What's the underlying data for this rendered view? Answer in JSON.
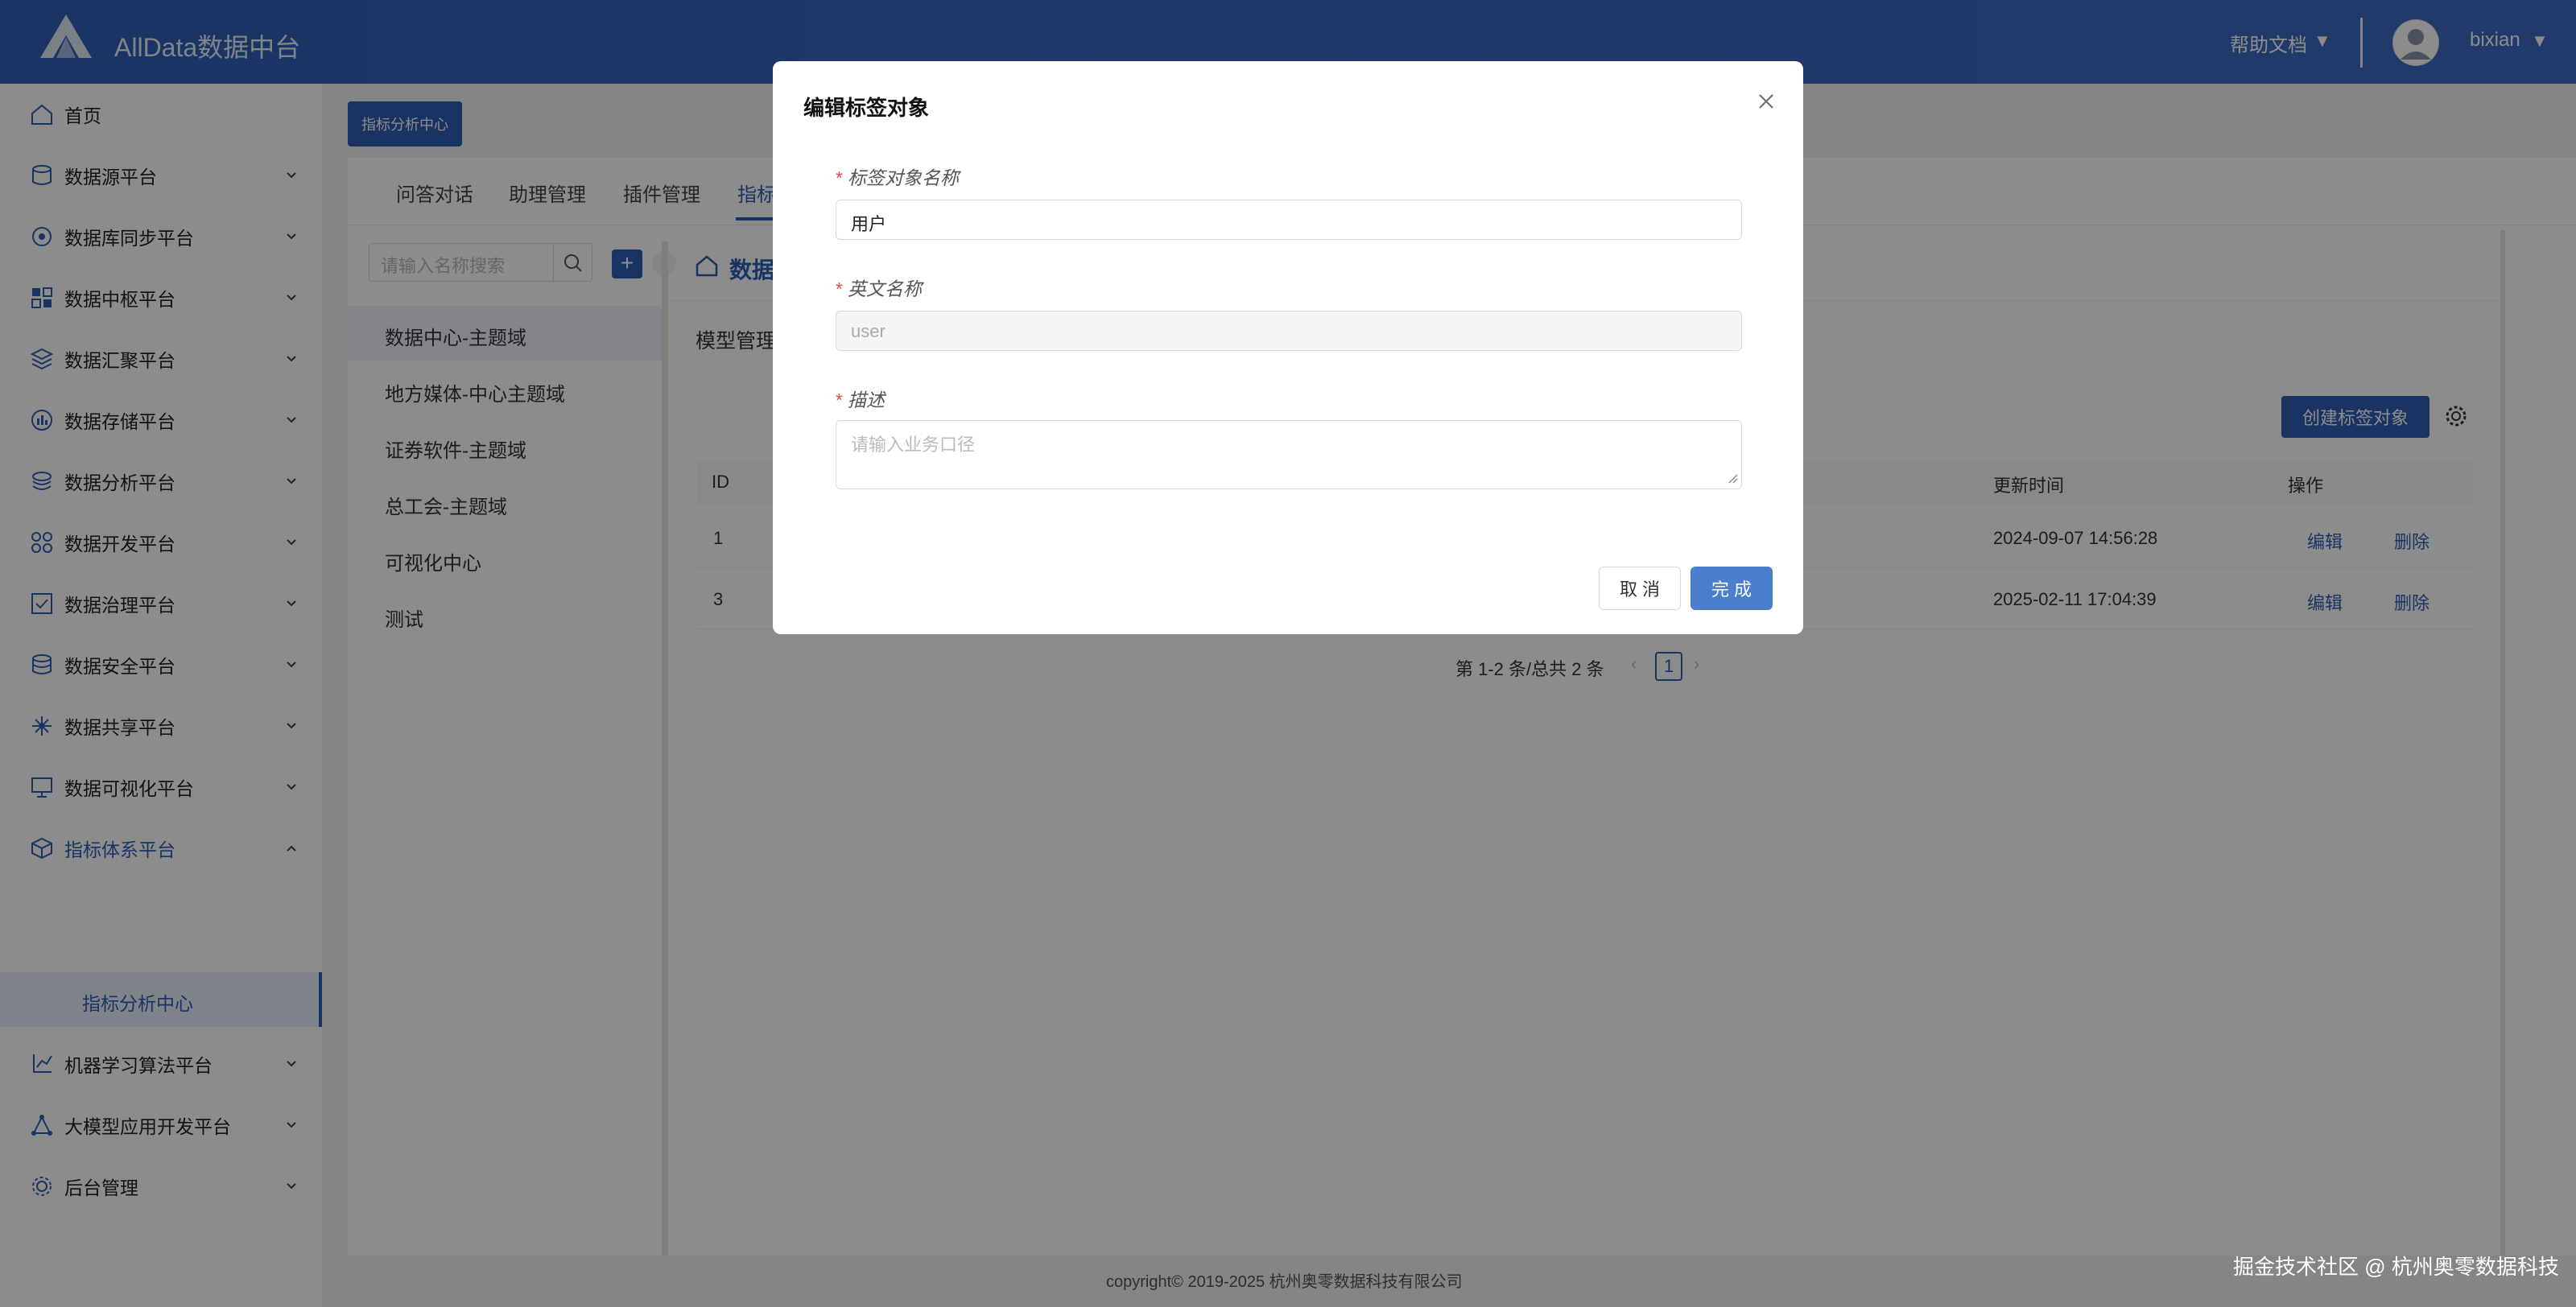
{
  "header": {
    "app_title": "AllData数据中台",
    "help_label": "帮助文档",
    "caret": "▼",
    "username": "bixian"
  },
  "sidebar": {
    "items": [
      {
        "label": "首页",
        "icon": "home-icon"
      },
      {
        "label": "数据源平台",
        "icon": "database-icon"
      },
      {
        "label": "数据库同步平台",
        "icon": "sync-icon"
      },
      {
        "label": "数据中枢平台",
        "icon": "grid-icon"
      },
      {
        "label": "数据汇聚平台",
        "icon": "stack-icon"
      },
      {
        "label": "数据存储平台",
        "icon": "storage-icon"
      },
      {
        "label": "数据分析平台",
        "icon": "layers-icon"
      },
      {
        "label": "数据开发平台",
        "icon": "apps-icon"
      },
      {
        "label": "数据治理平台",
        "icon": "check-icon"
      },
      {
        "label": "数据安全平台",
        "icon": "shield-db-icon"
      },
      {
        "label": "数据共享平台",
        "icon": "share-icon"
      },
      {
        "label": "数据可视化平台",
        "icon": "monitor-icon"
      },
      {
        "label": "指标体系平台",
        "icon": "cube-icon"
      },
      {
        "label": "机器学习算法平台",
        "icon": "ml-icon"
      },
      {
        "label": "大模型应用开发平台",
        "icon": "network-icon"
      },
      {
        "label": "后台管理",
        "icon": "admin-gear-icon"
      }
    ],
    "sub_item": "指标分析中心"
  },
  "content": {
    "tag_button": "指标分析中心",
    "tabs": [
      "问答对话",
      "助理管理",
      "插件管理",
      "指标"
    ],
    "search_placeholder": "请输入名称搜索",
    "plus": "+",
    "collapse": "‹",
    "tree": [
      "数据中心-主题域",
      "地方媒体-中心主题域",
      "证券软件-主题域",
      "总工会-主题域",
      "可视化中心",
      "测试"
    ],
    "breadcrumb": "数据",
    "section_title": "模型管理",
    "create_button": "创建标签对象",
    "table": {
      "headers": {
        "id": "ID",
        "updated": "更新时间",
        "actions": "操作"
      },
      "rows": [
        {
          "id": "1",
          "updated": "2024-09-07 14:56:28",
          "edit": "编辑",
          "delete": "删除"
        },
        {
          "id": "3",
          "updated": "2025-02-11 17:04:39",
          "edit": "编辑",
          "delete": "删除"
        }
      ]
    },
    "pager": {
      "summary": "第 1-2 条/总共 2 条",
      "current": "1",
      "prev": "‹",
      "next": "›"
    }
  },
  "footer": {
    "copyright": "copyright© 2019-2025 杭州奥零数据科技有限公司",
    "watermark": "掘金技术社区 @ 杭州奥零数据科技"
  },
  "modal": {
    "title": "编辑标签对象",
    "required_mark": "*",
    "fields": {
      "name_label": "标签对象名称",
      "name_value": "用户",
      "en_label": "英文名称",
      "en_value": "user",
      "desc_label": "描述",
      "desc_placeholder": "请输入业务口径"
    },
    "cancel": "取 消",
    "ok": "完 成"
  },
  "colors": {
    "primary": "#2f5fb5",
    "danger": "#e5484d",
    "button_ok": "#4a7fce"
  }
}
